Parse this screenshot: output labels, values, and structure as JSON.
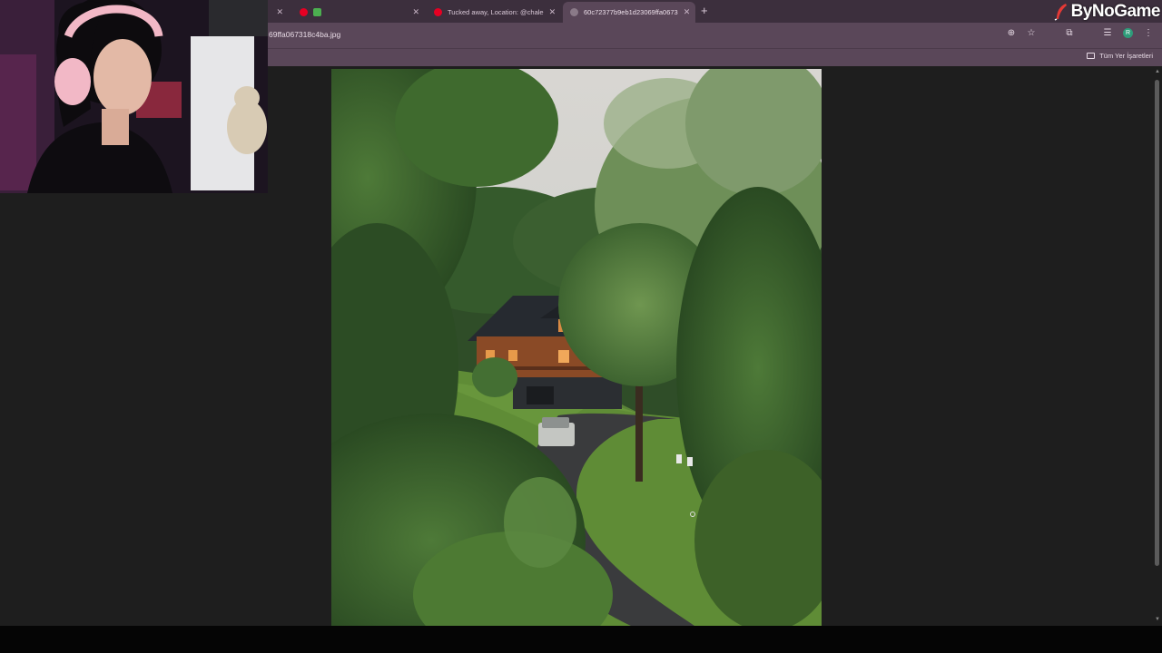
{
  "browser": {
    "tabs": [
      {
        "label": "",
        "favicon": "pinterest-icon"
      },
      {
        "label": "Tucked away, Location: @chale",
        "favicon": "pinterest-icon"
      },
      {
        "label": "60c72377b9eb1d23069ffa0673",
        "favicon": "image-icon",
        "active": true
      }
    ],
    "new_tab_label": "+",
    "url": "69ffa067318c4ba.jpg",
    "bookmarks_all_label": "Tüm Yer İşaretleri",
    "profile_initial": "R"
  },
  "overlay": {
    "logo_text": "ByNoGame"
  },
  "colors": {
    "tabstrip": "#3c2f3d",
    "toolbar": "#5a4759",
    "viewer_bg": "#1e1e1e",
    "logo_accent": "#e53935"
  }
}
